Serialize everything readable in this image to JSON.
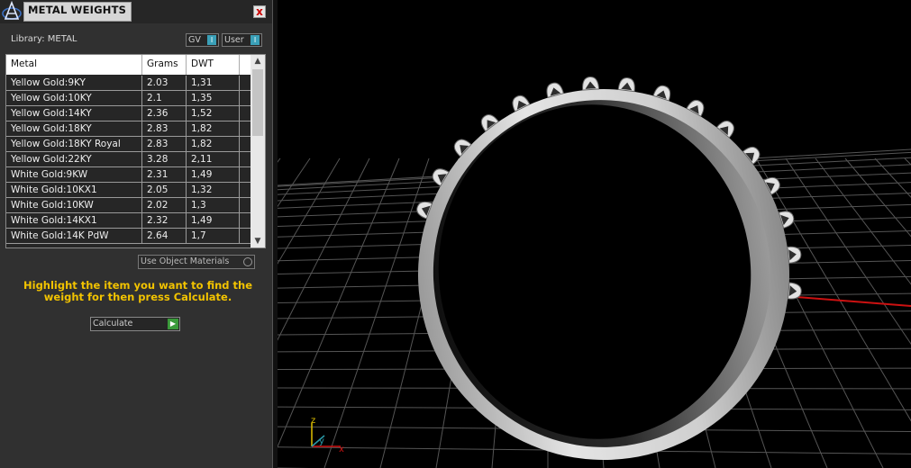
{
  "panel": {
    "title": "METAL WEIGHTS",
    "close_label": "x",
    "library_label": "Library: METAL",
    "options": {
      "gv_label": "GV",
      "user_label": "User"
    },
    "table": {
      "columns": [
        "Metal",
        "Grams",
        "DWT"
      ],
      "rows": [
        [
          "Yellow Gold:9KY",
          "2.03",
          "1,31"
        ],
        [
          "Yellow Gold:10KY",
          "2.1",
          "1,35"
        ],
        [
          "Yellow Gold:14KY",
          "2.36",
          "1,52"
        ],
        [
          "Yellow Gold:18KY",
          "2.83",
          "1,82"
        ],
        [
          "Yellow Gold:18KY Royal",
          "2.83",
          "1,82"
        ],
        [
          "Yellow Gold:22KY",
          "3.28",
          "2,11"
        ],
        [
          "White Gold:9KW",
          "2.31",
          "1,49"
        ],
        [
          "White Gold:10KX1",
          "2.05",
          "1,32"
        ],
        [
          "White Gold:10KW",
          "2.02",
          "1,3"
        ],
        [
          "White Gold:14KX1",
          "2.32",
          "1,49"
        ],
        [
          "White Gold:14K PdW",
          "2.64",
          "1,7"
        ]
      ]
    },
    "use_object_materials_label": "Use Object Materials",
    "hint": "Highlight the item you want to find the weight for then press Calculate.",
    "calculate_label": "Calculate"
  },
  "viewport": {
    "axis_labels": {
      "z": "z",
      "y": "y",
      "x": "x"
    },
    "colors": {
      "grid": "#555555",
      "x_axis": "#cc1111",
      "y_axis": "#2a9aa8",
      "ring": "#d0d0d0",
      "hint": "#f2c300"
    }
  }
}
